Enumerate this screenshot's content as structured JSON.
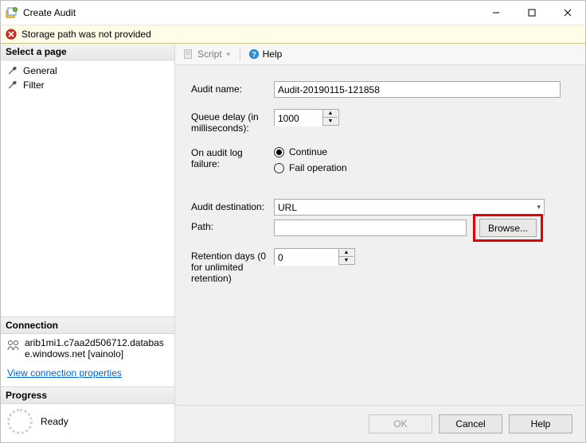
{
  "window": {
    "title": "Create Audit"
  },
  "error_bar": {
    "message": "Storage path was not provided"
  },
  "left": {
    "pages_header": "Select a page",
    "pages": [
      {
        "label": "General"
      },
      {
        "label": "Filter"
      }
    ],
    "connection_header": "Connection",
    "connection_text": "arib1mi1.c7aa2d506712.database.windows.net [vainolo]",
    "view_props_link": "View connection properties",
    "progress_header": "Progress",
    "progress_status": "Ready"
  },
  "toolbar": {
    "script_label": "Script",
    "help_label": "Help"
  },
  "form": {
    "audit_name_label": "Audit name:",
    "audit_name_value": "Audit-20190115-121858",
    "queue_delay_label": "Queue delay (in milliseconds):",
    "queue_delay_value": "1000",
    "on_failure_label": "On audit log failure:",
    "on_failure_options": [
      "Continue",
      "Fail operation"
    ],
    "on_failure_selected": 0,
    "destination_label": "Audit destination:",
    "destination_value": "URL",
    "path_label": "Path:",
    "path_value": "",
    "browse_label": "Browse...",
    "retention_label": "Retention days (0 for unlimited retention)",
    "retention_value": "0"
  },
  "footer": {
    "ok": "OK",
    "cancel": "Cancel",
    "help": "Help"
  }
}
